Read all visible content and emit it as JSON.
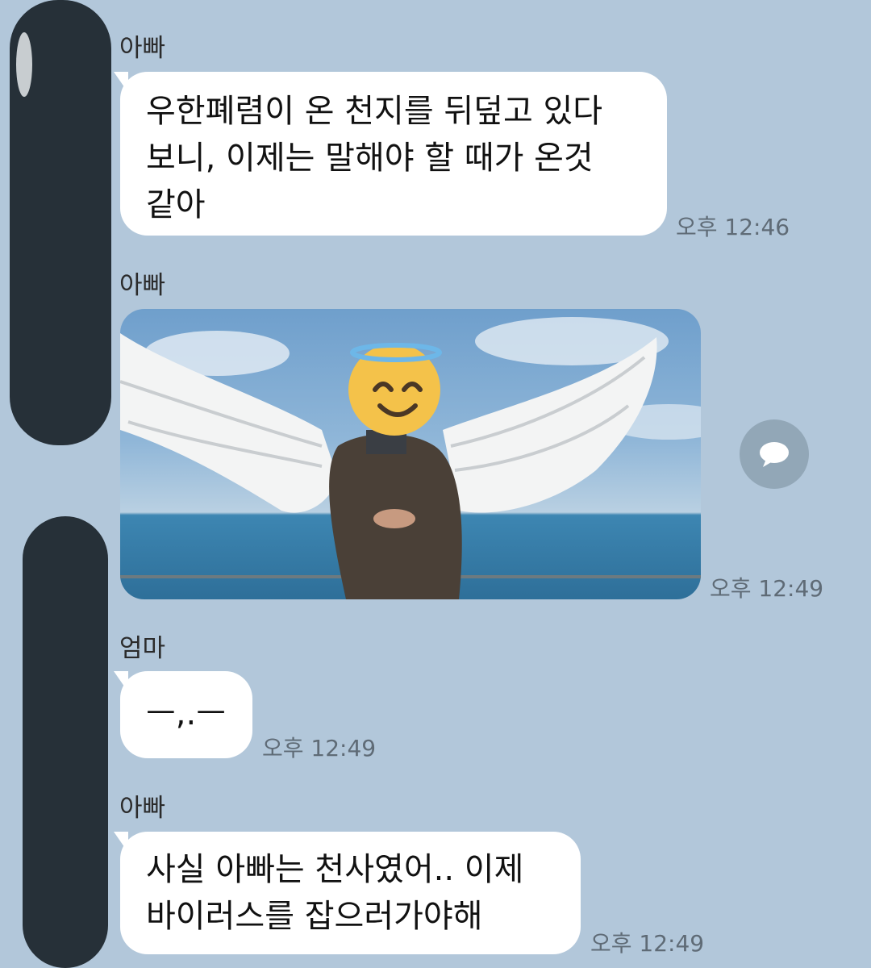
{
  "messages": [
    {
      "sender": "아빠",
      "type": "text",
      "lines": [
        "우한폐렴이 온 천지를 뒤덮고 있다",
        "보니,  이제는 말해야 할 때가 온것",
        "같아"
      ],
      "time": "오후 12:46"
    },
    {
      "sender": "아빠",
      "type": "image",
      "time": "오후 12:49",
      "image_desc_icon": "photo-angel-wings"
    },
    {
      "sender": "엄마",
      "type": "text",
      "lines": [
        "ㅡ,.ㅡ"
      ],
      "time": "오후 12:49"
    },
    {
      "sender": "아빠",
      "type": "text",
      "lines": [
        "사실 아빠는 천사였어.. 이제",
        "바이러스를 잡으러가야해"
      ],
      "time": "오후 12:49"
    }
  ],
  "icons": {
    "share": "chat-share-icon",
    "face": "smiling-face-with-halo-icon"
  },
  "colors": {
    "background": "#b2c7da",
    "bubble": "#ffffff",
    "redaction": "#263038"
  }
}
